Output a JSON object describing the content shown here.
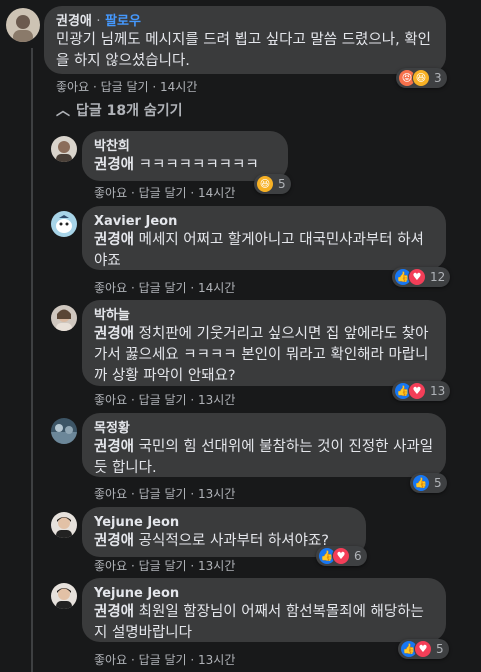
{
  "top_comment": {
    "author": "권경애",
    "separator": "·",
    "follow_label": "팔로우",
    "text": "민광기 님께도 메시지를 드려 뵙고 싶다고 말씀 드렸으나, 확인을 하지 않으셨습니다.",
    "actions": {
      "like": "좋아요",
      "reply": "답글 달기",
      "time": "14시간"
    },
    "reactions": {
      "icons": [
        "angry-icon",
        "haha-icon"
      ],
      "count": "3"
    }
  },
  "hide_replies_label": "답글 18개 숨기기",
  "replies": [
    {
      "author": "박찬희",
      "mention": "권경애",
      "text": "ㅋㅋㅋㅋㅋㅋㅋㅋㅋ",
      "actions": {
        "like": "좋아요",
        "reply": "답글 달기",
        "time": "14시간"
      },
      "reactions": {
        "icons": [
          "haha-icon"
        ],
        "count": "5"
      }
    },
    {
      "author": "Xavier Jeon",
      "mention": "권경애",
      "text": "메세지 어쩌고 할게아니고 대국민사과부터 하셔야죠",
      "actions": {
        "like": "좋아요",
        "reply": "답글 달기",
        "time": "14시간"
      },
      "reactions": {
        "icons": [
          "like-icon",
          "love-icon"
        ],
        "count": "12"
      }
    },
    {
      "author": "박하늘",
      "mention": "권경애",
      "text": "정치판에 기웃거리고 싶으시면 집 앞에라도 찾아가서 꿇으세요 ㅋㅋㅋㅋ 본인이 뭐라고 확인해라 마랍니까 상황 파악이 안돼요?",
      "actions": {
        "like": "좋아요",
        "reply": "답글 달기",
        "time": "13시간"
      },
      "reactions": {
        "icons": [
          "like-icon",
          "love-icon"
        ],
        "count": "13"
      }
    },
    {
      "author": "목정황",
      "mention": "권경애",
      "text": "국민의 힘 선대위에 불참하는 것이 진정한 사과일 듯 합니다.",
      "actions": {
        "like": "좋아요",
        "reply": "답글 달기",
        "time": "13시간"
      },
      "reactions": {
        "icons": [
          "like-icon"
        ],
        "count": "5"
      }
    },
    {
      "author": "Yejune Jeon",
      "mention": "권경애",
      "text": "공식적으로 사과부터 하셔야죠?",
      "actions": {
        "like": "좋아요",
        "reply": "답글 달기",
        "time": "13시간"
      },
      "reactions": {
        "icons": [
          "like-icon",
          "love-icon"
        ],
        "count": "6"
      }
    },
    {
      "author": "Yejune Jeon",
      "mention": "권경애",
      "text": "최원일 함장님이 어째서 함선복몰죄에 해당하는 지 설명바랍니다",
      "actions": {
        "like": "좋아요",
        "reply": "답글 달기",
        "time": "13시간"
      },
      "reactions": {
        "icons": [
          "like-icon",
          "love-icon"
        ],
        "count": "5"
      }
    }
  ]
}
